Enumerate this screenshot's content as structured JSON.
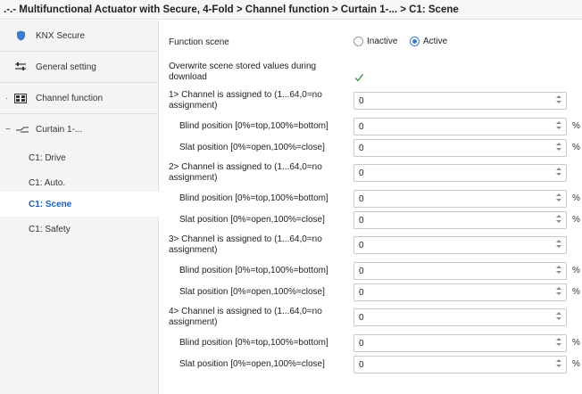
{
  "title": ".-.- Multifunctional Actuator with Secure, 4-Fold > Channel function > Curtain 1-... > C1: Scene",
  "sidebar": {
    "items": [
      {
        "label": "KNX Secure"
      },
      {
        "label": "General setting"
      },
      {
        "label": "Channel function"
      },
      {
        "label": "Curtain 1-..."
      },
      {
        "label": "C1: Drive"
      },
      {
        "label": "C1: Auto."
      },
      {
        "label": "C1: Scene"
      },
      {
        "label": "C1: Safety"
      }
    ],
    "active_index": 6
  },
  "content": {
    "function_scene": {
      "label": "Function scene",
      "options": [
        "Inactive",
        "Active"
      ],
      "selected": "Active"
    },
    "overwrite": {
      "label_line1": "Overwrite scene stored values during",
      "label_line2": "download",
      "checked": true
    },
    "channels": [
      {
        "assign_label_line1": "1> Channel is assigned to (1...64,0=no",
        "assign_label_line2": "assignment)",
        "assign_value": "0",
        "blind_label": "Blind position [0%=top,100%=bottom]",
        "blind_value": "0",
        "blind_unit": "%",
        "slat_label": "Slat position [0%=open,100%=close]",
        "slat_value": "0",
        "slat_unit": "%"
      },
      {
        "assign_label_line1": "2> Channel is assigned to (1...64,0=no",
        "assign_label_line2": "assignment)",
        "assign_value": "0",
        "blind_label": "Blind position [0%=top,100%=bottom]",
        "blind_value": "0",
        "blind_unit": "%",
        "slat_label": "Slat position [0%=open,100%=close]",
        "slat_value": "0",
        "slat_unit": "%"
      },
      {
        "assign_label_line1": "3> Channel is assigned to (1...64,0=no",
        "assign_label_line2": "assignment)",
        "assign_value": "0",
        "blind_label": "Blind position [0%=top,100%=bottom]",
        "blind_value": "0",
        "blind_unit": "%",
        "slat_label": "Slat position [0%=open,100%=close]",
        "slat_value": "0",
        "slat_unit": "%"
      },
      {
        "assign_label_line1": "4> Channel is assigned to (1...64,0=no",
        "assign_label_line2": "assignment)",
        "assign_value": "0",
        "blind_label": "Blind position [0%=top,100%=bottom]",
        "blind_value": "0",
        "blind_unit": "%",
        "slat_label": "Slat position [0%=open,100%=close]",
        "slat_value": "0",
        "slat_unit": "%"
      }
    ]
  },
  "colors": {
    "accent": "#3b7bd0",
    "active_nav_text": "#1a5fb4",
    "sidebar_bg": "#f4f4f4"
  },
  "icons": {
    "knx_secure": "shield-icon",
    "general_setting": "sliders-icon",
    "channel_function": "panel-icon",
    "curtain": "curtain-icon"
  }
}
